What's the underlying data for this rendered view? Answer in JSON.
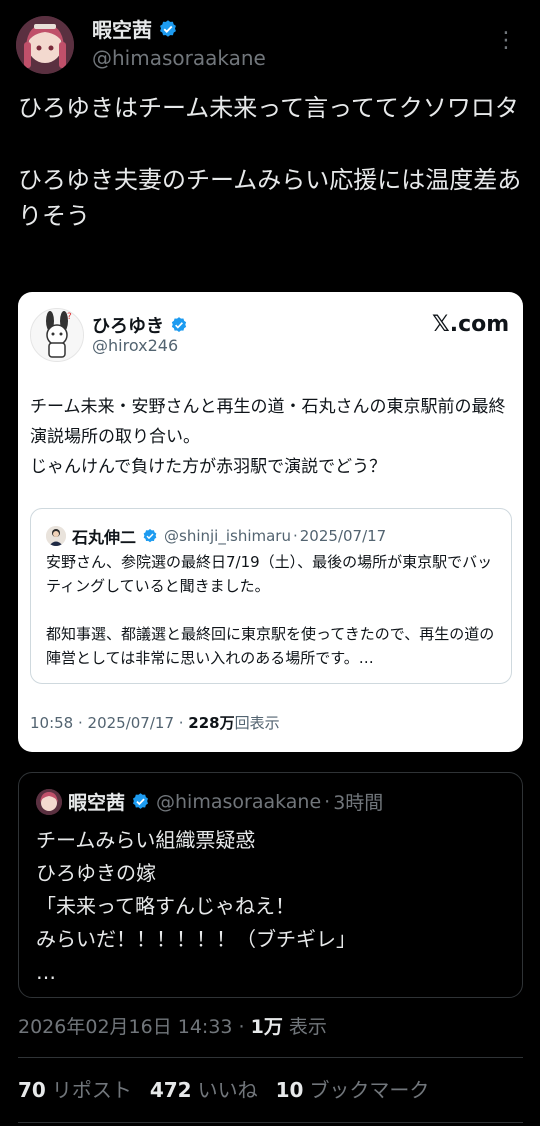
{
  "author": {
    "name": "暇空茜",
    "handle": "@himasoraakane",
    "avatar_icon": "anime-girl-avatar"
  },
  "more_label": "⋮",
  "tweet_text": "ひろゆきはチーム未来って言っててクソワロタ\n\nひろゆき夫妻のチームみらい応援には温度差ありそう",
  "embedded": {
    "author_name": "ひろゆき",
    "author_handle": "@hirox246",
    "brand": "𝕏.com",
    "text": "チーム未来・安野さんと再生の道・石丸さんの東京駅前の最終演説場所の取り合い。\nじゃんけんで負けた方が赤羽駅で演説でどう？",
    "quote": {
      "author_name": "石丸伸二",
      "author_handle": "@shinji_ishimaru",
      "date": "2025/07/17",
      "text": "安野さん、参院選の最終日7/19（土）、最後の場所が東京駅でバッティングしていると聞きました。\n\n都知事選、都議選と最終回に東京駅を使ってきたので、再生の道の陣営としては非常に思い入れのある場所です。…"
    },
    "footer_time": "10:58 · 2025/07/17 · ",
    "footer_views": "228万",
    "footer_views_label": "回表示"
  },
  "quote_tweet": {
    "author_name": "暇空茜",
    "author_handle": "@himasoraakane",
    "time": "3時間",
    "text": "チームみらい組織票疑惑\nひろゆきの嫁\n「未来って略すんじゃねえ！\nみらいだ！！！！！！（ブチギレ」\n…"
  },
  "meta": {
    "timestamp": "2026年02月16日 14:33 · ",
    "views": "1万",
    "views_label": " 表示"
  },
  "stats": {
    "reposts_count": "70",
    "reposts_label": "リポスト",
    "likes_count": "472",
    "likes_label": "いいね",
    "bookmarks_count": "10",
    "bookmarks_label": "ブックマーク"
  },
  "colors": {
    "background": "#000000",
    "verified": "#1d9bf0",
    "muted": "#71767b",
    "border": "#2f3336"
  }
}
